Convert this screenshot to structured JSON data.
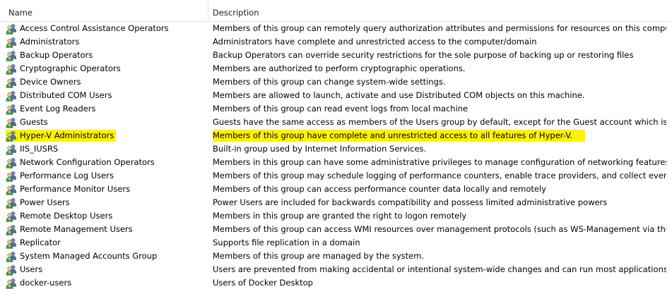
{
  "columns": {
    "name": "Name",
    "description": "Description"
  },
  "icon": "group-users-icon",
  "highlight_color": "#fdf200",
  "groups": [
    {
      "name": "Access Control Assistance Operators",
      "description": "Members of this group can remotely query authorization attributes and permissions for resources on this computer."
    },
    {
      "name": "Administrators",
      "description": "Administrators have complete and unrestricted access to the computer/domain"
    },
    {
      "name": "Backup Operators",
      "description": "Backup Operators can override security restrictions for the sole purpose of backing up or restoring files"
    },
    {
      "name": "Cryptographic Operators",
      "description": "Members are authorized to perform cryptographic operations."
    },
    {
      "name": "Device Owners",
      "description": "Members of this group can change system-wide settings."
    },
    {
      "name": "Distributed COM Users",
      "description": "Members are allowed to launch, activate and use Distributed COM objects on this machine."
    },
    {
      "name": "Event Log Readers",
      "description": "Members of this group can read event logs from local machine"
    },
    {
      "name": "Guests",
      "description": "Guests have the same access as members of the Users group by default, except for the Guest account which is further re..."
    },
    {
      "name": "Hyper-V Administrators",
      "description": "Members of this group have complete and unrestricted access to all features of Hyper-V.",
      "highlighted": true
    },
    {
      "name": "IIS_IUSRS",
      "description": "Built-in group used by Internet Information Services."
    },
    {
      "name": "Network Configuration Operators",
      "description": "Members in this group can have some administrative privileges to manage configuration of networking features"
    },
    {
      "name": "Performance Log Users",
      "description": "Members of this group may schedule logging of performance counters, enable trace providers, and collect event traces ..."
    },
    {
      "name": "Performance Monitor Users",
      "description": "Members of this group can access performance counter data locally and remotely"
    },
    {
      "name": "Power Users",
      "description": "Power Users are included for backwards compatibility and possess limited administrative powers"
    },
    {
      "name": "Remote Desktop Users",
      "description": "Members in this group are granted the right to logon remotely"
    },
    {
      "name": "Remote Management Users",
      "description": "Members of this group can access WMI resources over management protocols (such as WS-Management via the Wind..."
    },
    {
      "name": "Replicator",
      "description": "Supports file replication in a domain"
    },
    {
      "name": "System Managed Accounts Group",
      "description": "Members of this group are managed by the system."
    },
    {
      "name": "Users",
      "description": "Users are prevented from making accidental or intentional system-wide changes and can run most applications"
    },
    {
      "name": "docker-users",
      "description": "Users of Docker Desktop"
    }
  ]
}
